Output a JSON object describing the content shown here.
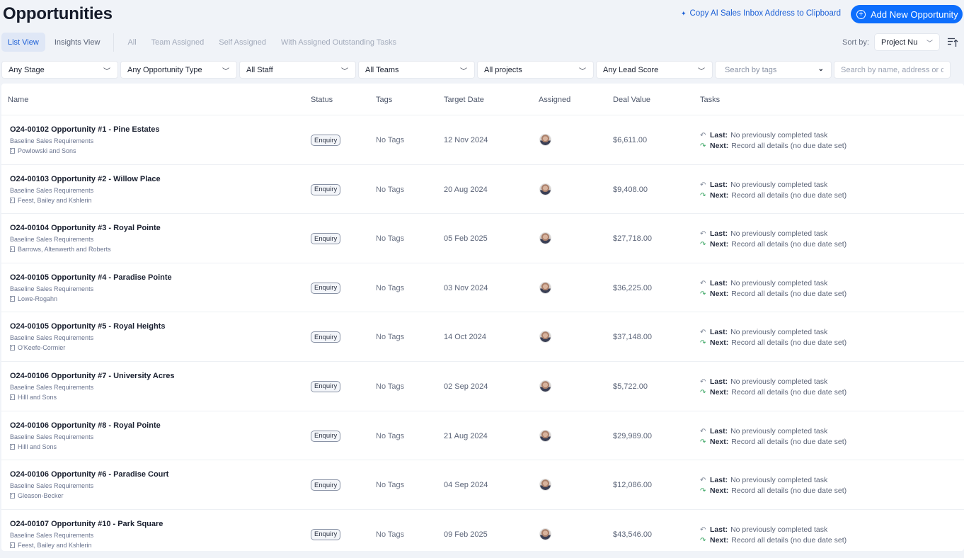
{
  "header": {
    "title": "Opportunities",
    "copy_link": "Copy AI Sales Inbox Address to Clipboard",
    "add_button": "Add New Opportunity"
  },
  "tabs": {
    "views": [
      {
        "label": "List View",
        "active": true
      },
      {
        "label": "Insights View",
        "active": false
      }
    ],
    "filters": [
      {
        "label": "All"
      },
      {
        "label": "Team Assigned"
      },
      {
        "label": "Self Assigned"
      },
      {
        "label": "With Assigned Outstanding Tasks"
      }
    ]
  },
  "sort": {
    "label": "Sort by:",
    "value": "Project Nu"
  },
  "filters": {
    "stage": "Any Stage",
    "opportunity_type": "Any Opportunity Type",
    "staff": "All Staff",
    "teams": "All Teams",
    "projects": "All projects",
    "lead_score": "Any Lead Score",
    "tags_placeholder": "Search by tags",
    "search_placeholder": "Search by name, address or contact"
  },
  "table": {
    "columns": [
      "Name",
      "Status",
      "Tags",
      "Target Date",
      "Assigned",
      "Deal Value",
      "Tasks"
    ],
    "task_last_label": "Last:",
    "task_next_label": "Next:",
    "rows": [
      {
        "title": "O24-00102 Opportunity #1 - Pine Estates",
        "subtitle": "Baseline Sales Requirements",
        "client": "Powlowski and Sons",
        "status": "Enquiry",
        "tags": "No Tags",
        "target_date": "12 Nov 2024",
        "deal_value": "$6,611.00",
        "last_task": "No previously completed task",
        "next_task": "Record all details (no due date set)"
      },
      {
        "title": "O24-00103 Opportunity #2 - Willow Place",
        "subtitle": "Baseline Sales Requirements",
        "client": "Feest, Bailey and Kshlerin",
        "status": "Enquiry",
        "tags": "No Tags",
        "target_date": "20 Aug 2024",
        "deal_value": "$9,408.00",
        "last_task": "No previously completed task",
        "next_task": "Record all details (no due date set)"
      },
      {
        "title": "O24-00104 Opportunity #3 - Royal Pointe",
        "subtitle": "Baseline Sales Requirements",
        "client": "Barrows, Altenwerth and Roberts",
        "status": "Enquiry",
        "tags": "No Tags",
        "target_date": "05 Feb 2025",
        "deal_value": "$27,718.00",
        "last_task": "No previously completed task",
        "next_task": "Record all details (no due date set)"
      },
      {
        "title": "O24-00105 Opportunity #4 - Paradise Pointe",
        "subtitle": "Baseline Sales Requirements",
        "client": "Lowe-Rogahn",
        "status": "Enquiry",
        "tags": "No Tags",
        "target_date": "03 Nov 2024",
        "deal_value": "$36,225.00",
        "last_task": "No previously completed task",
        "next_task": "Record all details (no due date set)"
      },
      {
        "title": "O24-00105 Opportunity #5 - Royal Heights",
        "subtitle": "Baseline Sales Requirements",
        "client": "O'Keefe-Cormier",
        "status": "Enquiry",
        "tags": "No Tags",
        "target_date": "14 Oct 2024",
        "deal_value": "$37,148.00",
        "last_task": "No previously completed task",
        "next_task": "Record all details (no due date set)"
      },
      {
        "title": "O24-00106 Opportunity #7 - University Acres",
        "subtitle": "Baseline Sales Requirements",
        "client": "Hilll and Sons",
        "status": "Enquiry",
        "tags": "No Tags",
        "target_date": "02 Sep 2024",
        "deal_value": "$5,722.00",
        "last_task": "No previously completed task",
        "next_task": "Record all details (no due date set)"
      },
      {
        "title": "O24-00106 Opportunity #8 - Royal Pointe",
        "subtitle": "Baseline Sales Requirements",
        "client": "Hilll and Sons",
        "status": "Enquiry",
        "tags": "No Tags",
        "target_date": "21 Aug 2024",
        "deal_value": "$29,989.00",
        "last_task": "No previously completed task",
        "next_task": "Record all details (no due date set)"
      },
      {
        "title": "O24-00106 Opportunity #6 - Paradise Court",
        "subtitle": "Baseline Sales Requirements",
        "client": "Gleason-Becker",
        "status": "Enquiry",
        "tags": "No Tags",
        "target_date": "04 Sep 2024",
        "deal_value": "$12,086.00",
        "last_task": "No previously completed task",
        "next_task": "Record all details (no due date set)"
      },
      {
        "title": "O24-00107 Opportunity #10 - Park Square",
        "subtitle": "Baseline Sales Requirements",
        "client": "Feest, Bailey and Kshlerin",
        "status": "Enquiry",
        "tags": "No Tags",
        "target_date": "09 Feb 2025",
        "deal_value": "$43,546.00",
        "last_task": "No previously completed task",
        "next_task": "Record all details (no due date set)"
      }
    ]
  },
  "colors": {
    "accent": "#0d6efd",
    "link": "#1b5fd6",
    "next_task_icon": "#2fa05a",
    "background": "#f0f3f8"
  }
}
